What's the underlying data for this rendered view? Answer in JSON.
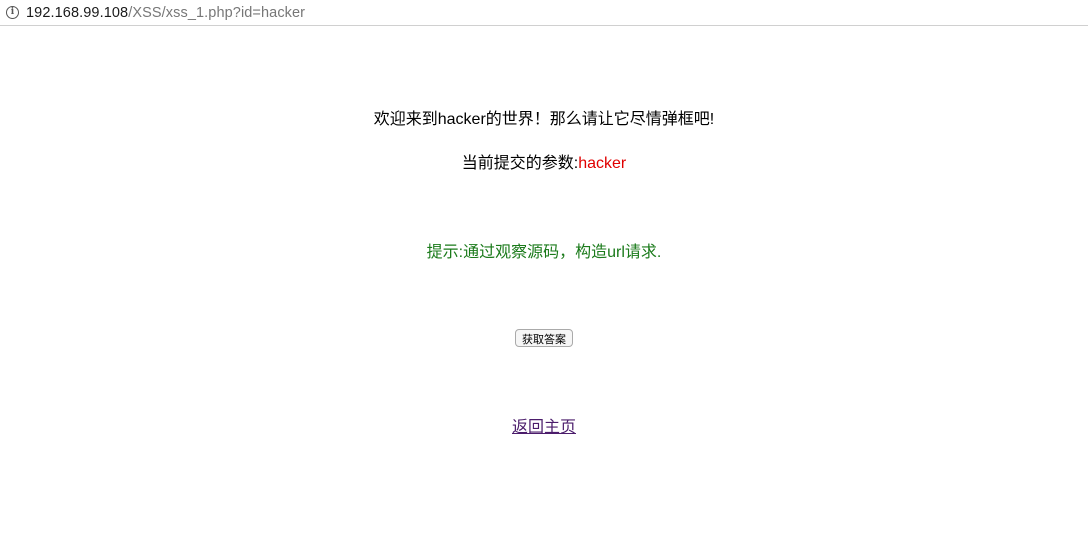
{
  "browser": {
    "url_host": "192.168.99.108",
    "url_path": "/XSS/xss_1.php?id=hacker",
    "info_icon": "i"
  },
  "page": {
    "welcome_text": "欢迎来到hacker的世界！那么请让它尽情弹框吧!",
    "param_label": "当前提交的参数:",
    "param_value": "hacker",
    "hint_text": "提示:通过观察源码，构造url请求.",
    "answer_button": "获取答案",
    "home_link": "返回主页"
  },
  "colors": {
    "param_value": "#e00000",
    "hint": "#1a7a1a",
    "link": "#4b1c6b"
  }
}
